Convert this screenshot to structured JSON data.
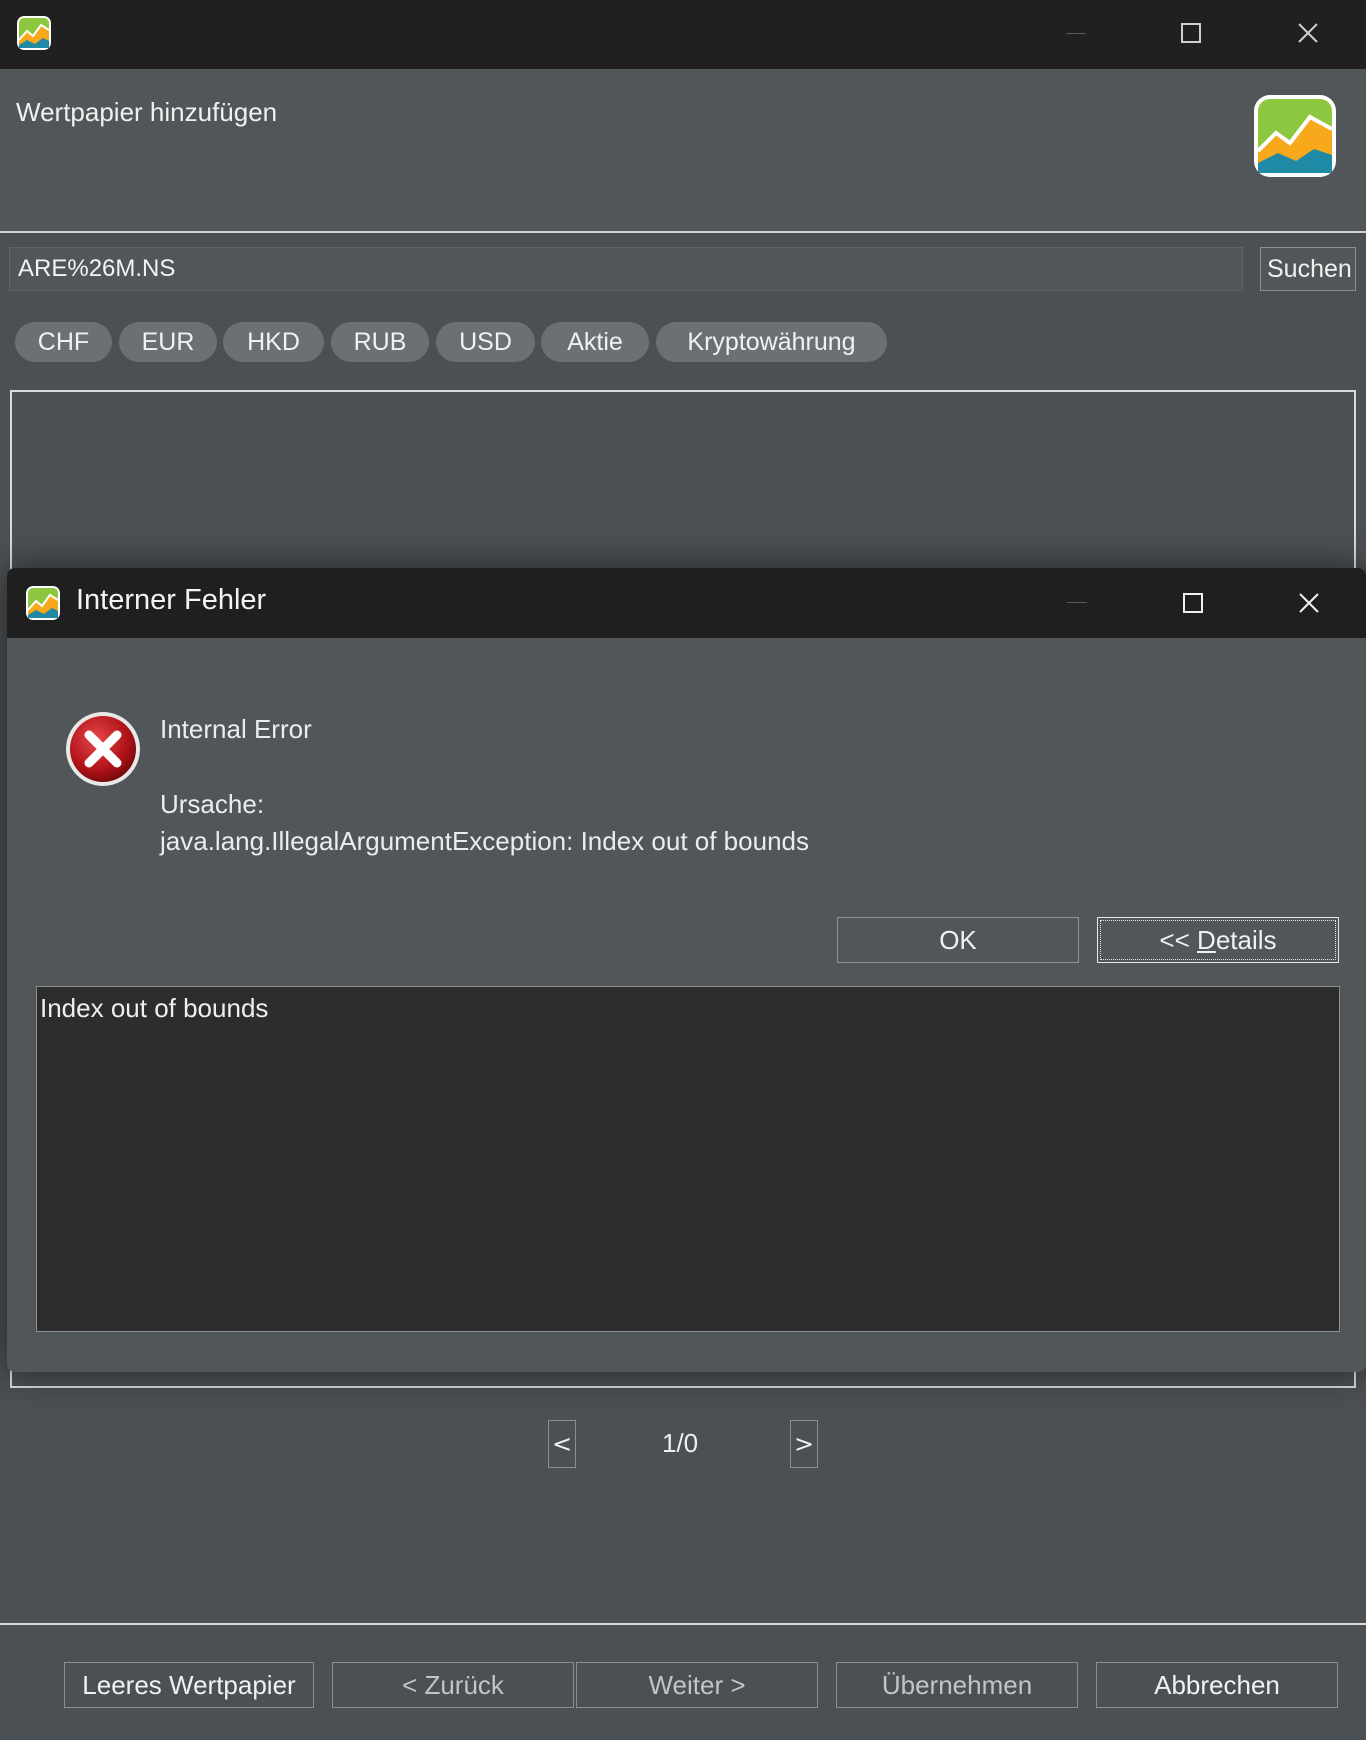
{
  "main_window": {
    "header_title": "Wertpapier hinzufügen"
  },
  "search": {
    "value": "ARE%26M.NS",
    "button_label": "Suchen"
  },
  "filter_chips": [
    "CHF",
    "EUR",
    "HKD",
    "RUB",
    "USD",
    "Aktie",
    "Kryptowährung"
  ],
  "pager": {
    "prev_label": "<",
    "text": "1/0",
    "next_label": ">"
  },
  "footer": {
    "empty_security": "Leeres Wertpapier",
    "back": "< Zurück",
    "next": "Weiter >",
    "apply": "Übernehmen",
    "cancel": "Abbrechen"
  },
  "dialog": {
    "title": "Interner Fehler",
    "message": "Internal Error",
    "cause_label": "Ursache:",
    "cause": "java.lang.IllegalArgumentException: Index out of bounds",
    "ok_label": "OK",
    "details_prefix": "<< ",
    "details_mnemonic": "D",
    "details_rest": "etails",
    "details_text": "Index out of bounds"
  },
  "icons": {
    "app": "app-chart-icon",
    "error": "error-x-icon",
    "minimize": "minimize-icon",
    "maximize": "maximize-icon",
    "close": "close-icon"
  },
  "colors": {
    "title_bar": "#202020",
    "panel_bg": "#515659",
    "content_bg": "#4b5054",
    "chip_bg": "#6b7073",
    "details_bg": "#2d2d2d",
    "logo_green": "#8dc63f",
    "logo_orange": "#f7a81b",
    "logo_teal": "#1f8aa6",
    "error_red": "#c4161c"
  }
}
